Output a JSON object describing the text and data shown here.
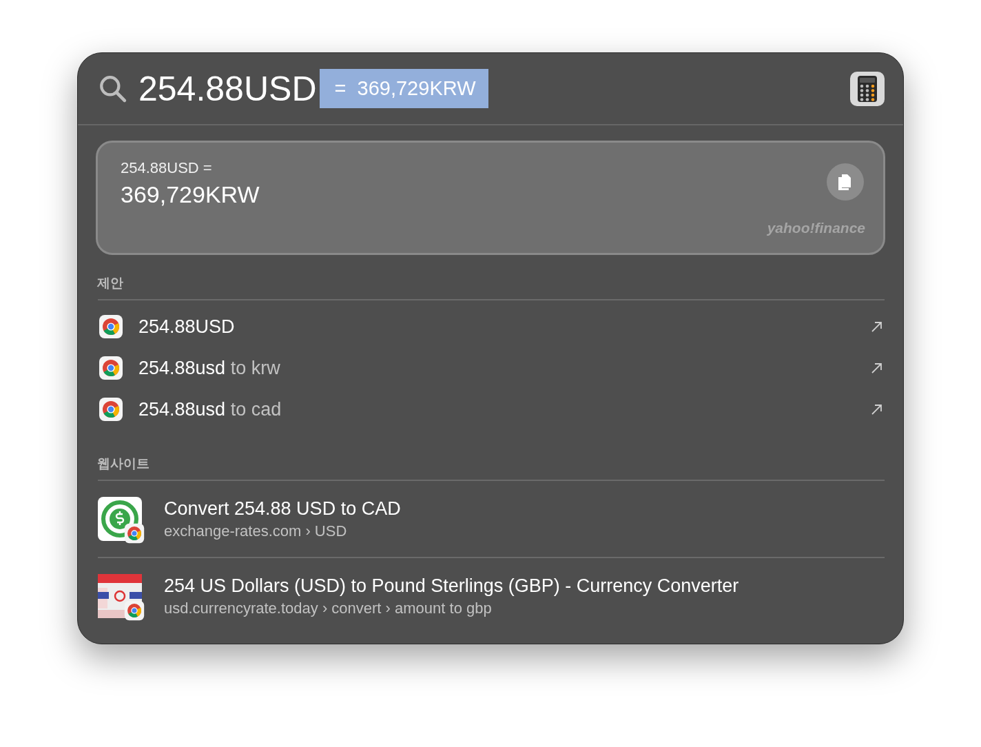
{
  "search": {
    "query": "254.88USD",
    "inline_result": "=  369,729KRW"
  },
  "conversion": {
    "expression": "254.88USD =",
    "result": "369,729KRW",
    "source": "yahoo!finance"
  },
  "suggestions": {
    "title": "제안",
    "items": [
      {
        "query": "254.88USD"
      },
      {
        "query": "254.88usd",
        "completion": " to krw"
      },
      {
        "query": "254.88usd",
        "completion": " to cad"
      }
    ]
  },
  "websites": {
    "title": "웹사이트",
    "items": [
      {
        "kind": "dollar",
        "title": "Convert 254.88 USD to CAD",
        "path": "exchange-rates.com › USD"
      },
      {
        "kind": "picture",
        "title": "254 US Dollars (USD) to Pound Sterlings (GBP) - Currency Converter",
        "path": "usd.currencyrate.today › convert › amount to gbp"
      }
    ]
  }
}
